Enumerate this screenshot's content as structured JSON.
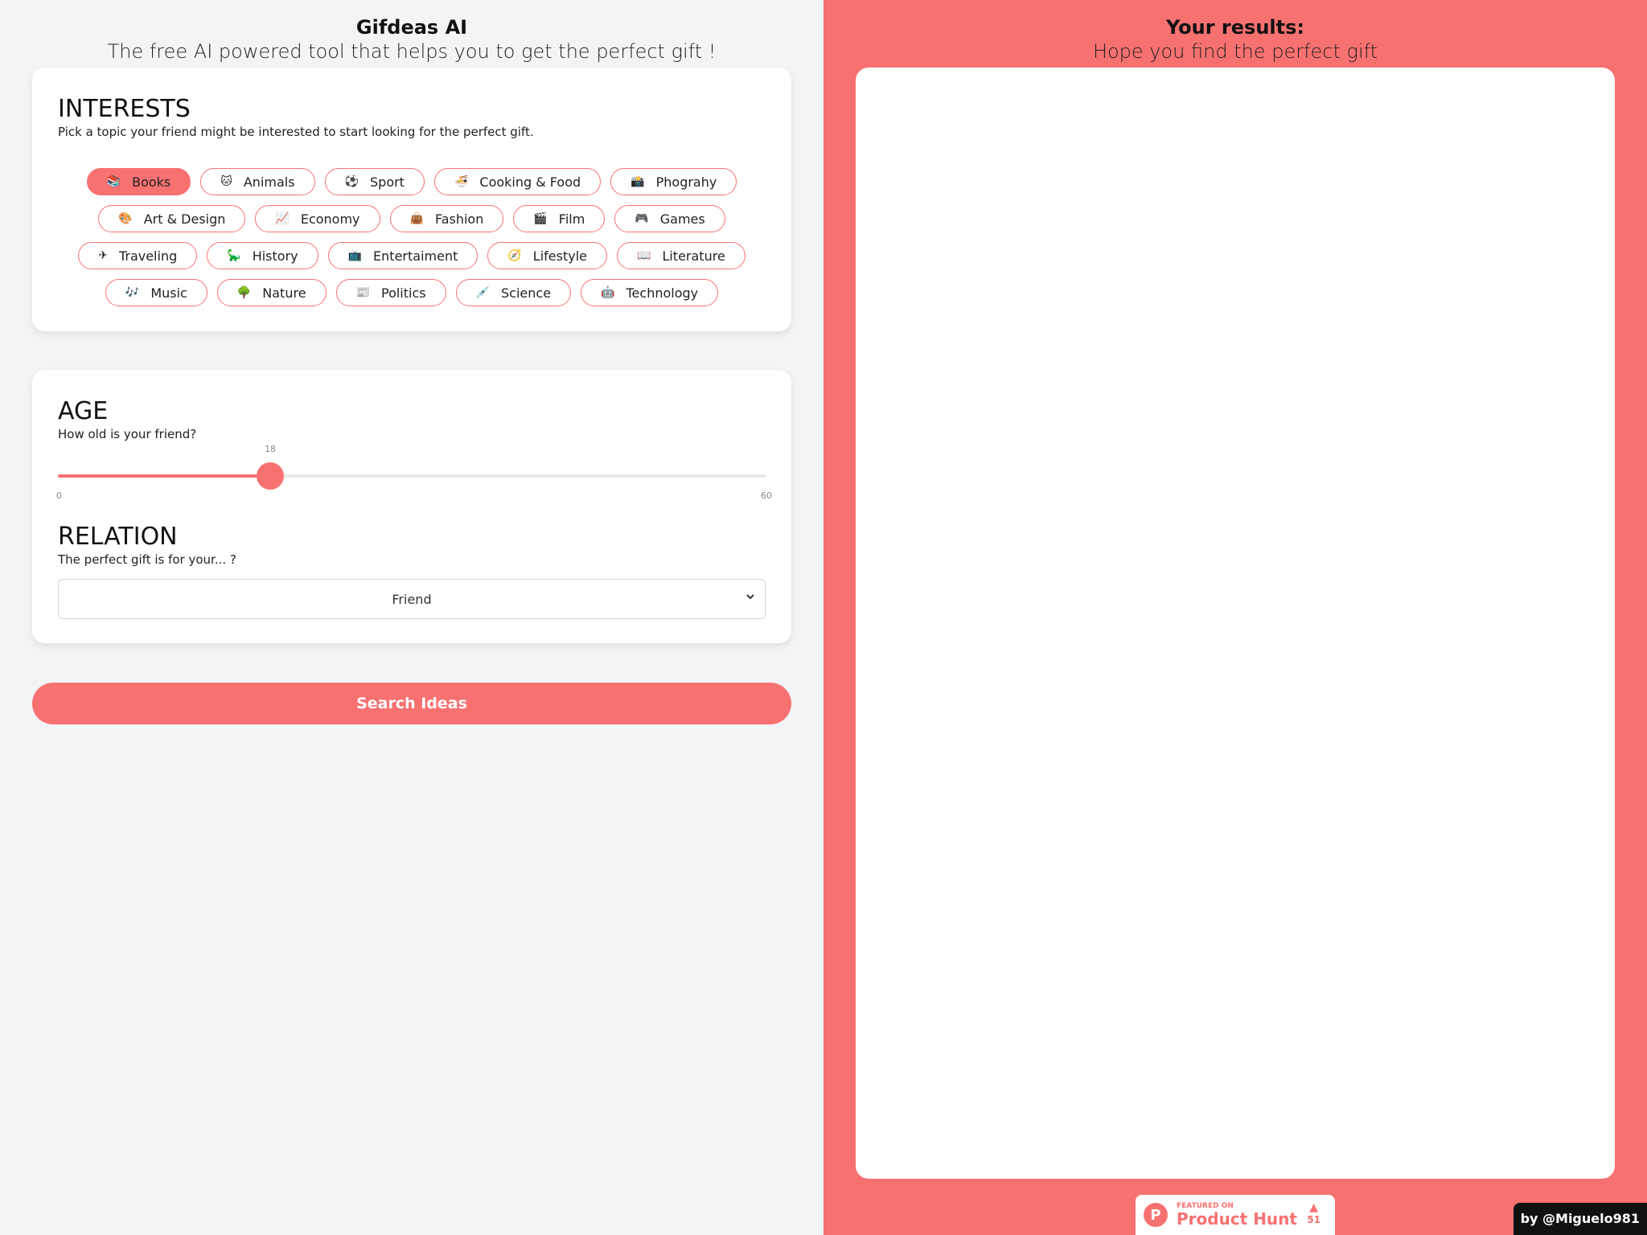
{
  "left": {
    "title": "Gifdeas AI",
    "subtitle": "The free AI powered tool that helps you to get the perfect gift !"
  },
  "interests": {
    "title": "INTERESTS",
    "description": "Pick a topic your friend might be interested to start looking for the perfect gift.",
    "rows": [
      [
        {
          "emoji": "📚",
          "label": "Books",
          "selected": true
        },
        {
          "emoji": "🐱",
          "label": "Animals",
          "selected": false
        },
        {
          "emoji": "⚽",
          "label": "Sport",
          "selected": false
        },
        {
          "emoji": "🍜",
          "label": "Cooking & Food",
          "selected": false
        },
        {
          "emoji": "📸",
          "label": "Phograhy",
          "selected": false
        }
      ],
      [
        {
          "emoji": "🎨",
          "label": "Art & Design",
          "selected": false
        },
        {
          "emoji": "📈",
          "label": "Economy",
          "selected": false
        },
        {
          "emoji": "👜",
          "label": "Fashion",
          "selected": false
        },
        {
          "emoji": "🎬",
          "label": "Film",
          "selected": false
        },
        {
          "emoji": "🎮",
          "label": "Games",
          "selected": false
        }
      ],
      [
        {
          "emoji": "✈",
          "label": "Traveling",
          "selected": false
        },
        {
          "emoji": "🦕",
          "label": "History",
          "selected": false
        },
        {
          "emoji": "📺",
          "label": "Entertaiment",
          "selected": false
        },
        {
          "emoji": "🧭",
          "label": "Lifestyle",
          "selected": false
        },
        {
          "emoji": "📖",
          "label": "Literature",
          "selected": false
        }
      ],
      [
        {
          "emoji": "🎶",
          "label": "Music",
          "selected": false
        },
        {
          "emoji": "🌳",
          "label": "Nature",
          "selected": false
        },
        {
          "emoji": "📰",
          "label": "Politics",
          "selected": false
        },
        {
          "emoji": "💉",
          "label": "Science",
          "selected": false
        },
        {
          "emoji": "🤖",
          "label": "Technology",
          "selected": false
        }
      ]
    ]
  },
  "age": {
    "title": "AGE",
    "description": "How old is your friend?",
    "value": "18",
    "min": "0",
    "max": "60"
  },
  "relation": {
    "title": "RELATION",
    "description": "The perfect gift is for your... ?",
    "selected": "Friend"
  },
  "search_button": "Search Ideas",
  "results": {
    "title": "Your results:",
    "subtitle": "Hope you find the perfect gift"
  },
  "product_hunt": {
    "small": "FEATURED ON",
    "big": "Product Hunt",
    "logo": "P",
    "arrow": "▲",
    "votes": "51"
  },
  "author": "by @Miguelo981",
  "colors": {
    "accent": "#f87171",
    "background": "#f3f4f6"
  }
}
